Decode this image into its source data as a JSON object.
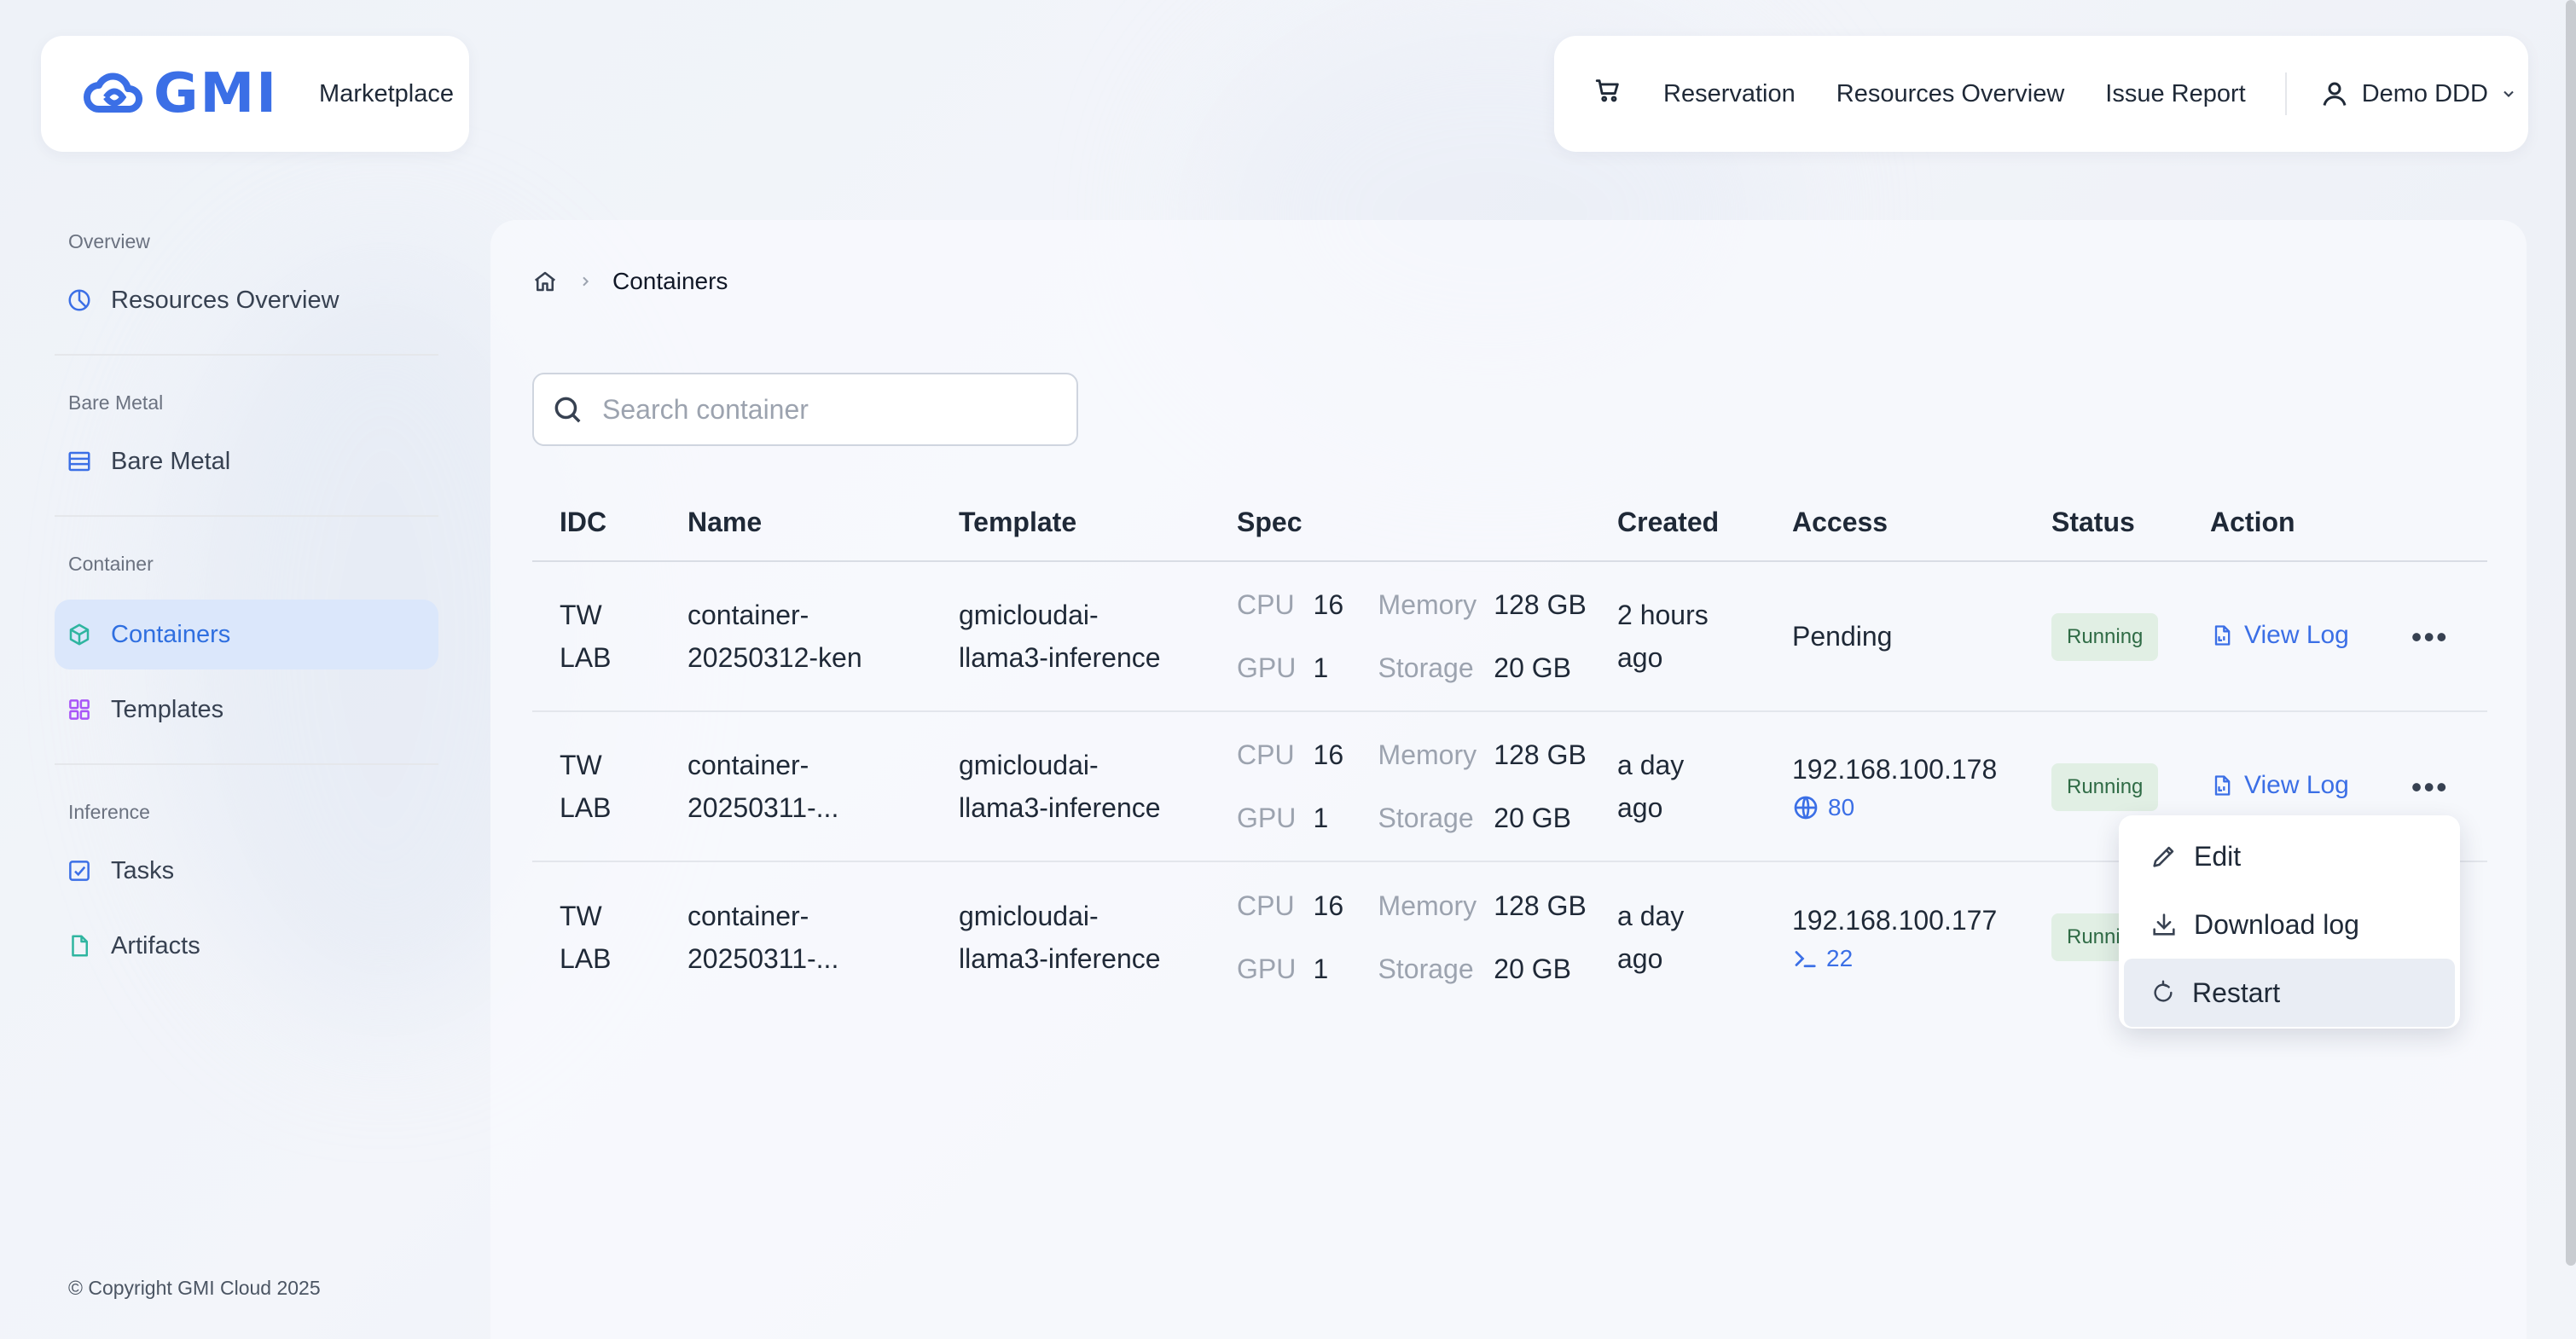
{
  "brand": {
    "logo": "GMI",
    "marketplace": "Marketplace"
  },
  "nav": {
    "items": [
      "Reservation",
      "Resources Overview",
      "Issue Report"
    ],
    "user": "Demo DDD"
  },
  "sidebar": {
    "sections": [
      {
        "label": "Overview",
        "items": [
          {
            "label": "Resources Overview",
            "icon": "pie-chart-icon"
          }
        ]
      },
      {
        "label": "Bare Metal",
        "items": [
          {
            "label": "Bare Metal",
            "icon": "server-icon"
          }
        ]
      },
      {
        "label": "Container",
        "items": [
          {
            "label": "Containers",
            "icon": "cube-icon",
            "active": true
          },
          {
            "label": "Templates",
            "icon": "grid-icon"
          }
        ]
      },
      {
        "label": "Inference",
        "items": [
          {
            "label": "Tasks",
            "icon": "checkbox-icon"
          },
          {
            "label": "Artifacts",
            "icon": "file-icon"
          }
        ]
      }
    ],
    "copyright": "© Copyright GMI Cloud 2025"
  },
  "breadcrumb": {
    "current": "Containers"
  },
  "search": {
    "placeholder": "Search container",
    "value": ""
  },
  "table": {
    "headers": [
      "IDC",
      "Name",
      "Template",
      "Spec",
      "Created",
      "Access",
      "Status",
      "Action"
    ],
    "spec_labels": {
      "cpu": "CPU",
      "memory": "Memory",
      "gpu": "GPU",
      "storage": "Storage"
    },
    "rows": [
      {
        "idc": [
          "TW",
          "LAB"
        ],
        "name": [
          "container-",
          "20250312-ken"
        ],
        "template": [
          "gmicloudai-",
          "llama3-inference"
        ],
        "cpu": "16",
        "memory": "128 GB",
        "gpu": "1",
        "storage": "20 GB",
        "created": [
          "2 hours",
          "ago"
        ],
        "access": "Pending",
        "access_sub": "",
        "status": "Running",
        "action": "View Log"
      },
      {
        "idc": [
          "TW",
          "LAB"
        ],
        "name": [
          "container-",
          "20250311-..."
        ],
        "template": [
          "gmicloudai-",
          "llama3-inference"
        ],
        "cpu": "16",
        "memory": "128 GB",
        "gpu": "1",
        "storage": "20 GB",
        "created": [
          "a day",
          "ago"
        ],
        "access": "192.168.100.178",
        "access_sub": "80",
        "status": "Running",
        "action": "View Log"
      },
      {
        "idc": [
          "TW",
          "LAB"
        ],
        "name": [
          "container-",
          "20250311-..."
        ],
        "template": [
          "gmicloudai-",
          "llama3-inference"
        ],
        "cpu": "16",
        "memory": "128 GB",
        "gpu": "1",
        "storage": "20 GB",
        "created": [
          "a day",
          "ago"
        ],
        "access": "192.168.100.177",
        "access_sub": "22",
        "status": "Runni",
        "action": ""
      }
    ]
  },
  "dropdown": {
    "items": [
      "Edit",
      "Download log",
      "Restart"
    ],
    "highlighted": "Restart"
  },
  "colors": {
    "accent": "#3b6fe6",
    "status_bg": "#e1efe4",
    "status_text": "#2f6b45",
    "active_bg": "#dbe7fb"
  }
}
